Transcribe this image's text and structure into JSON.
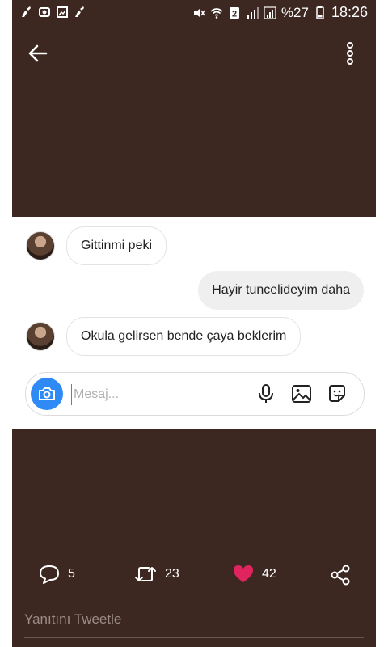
{
  "status_bar": {
    "battery_percent": "%27",
    "time": "18:26"
  },
  "chat": {
    "messages": [
      {
        "direction": "incoming",
        "text": "Gittinmi peki"
      },
      {
        "direction": "outgoing",
        "text": "Hayir tuncelideyim daha"
      },
      {
        "direction": "incoming",
        "text": "Okula gelirsen bende çaya beklerim"
      }
    ],
    "composer": {
      "placeholder": "Mesaj...",
      "value": ""
    }
  },
  "tweet_actions": {
    "replies": "5",
    "retweets": "23",
    "likes": "42",
    "like_color": "#e0245e"
  },
  "reply_prompt": "Yanıtını Tweetle",
  "colors": {
    "background": "#3c2721",
    "accent": "#2f8af5"
  }
}
